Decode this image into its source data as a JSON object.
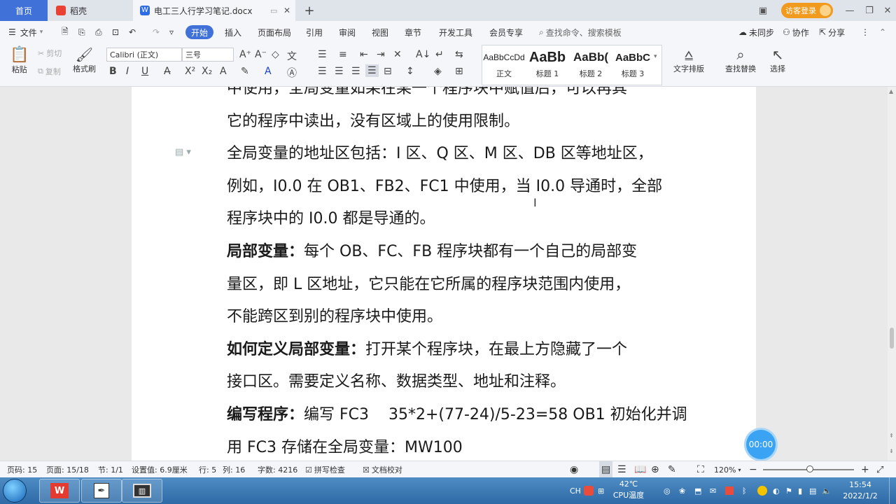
{
  "tabs": {
    "home": "首页",
    "daoke": "稻壳",
    "doc": "电工三人行学习笔记.docx",
    "add": "+"
  },
  "login": "访客登录",
  "menu": {
    "file": "文件",
    "start": "开始",
    "insert": "插入",
    "layout": "页面布局",
    "reference": "引用",
    "review": "审阅",
    "view": "视图",
    "chapter": "章节",
    "devtools": "开发工具",
    "member": "会员专享",
    "search": "查找命令、搜索模板",
    "sync": "未同步",
    "collab": "协作",
    "share": "分享"
  },
  "ribbon": {
    "paste": "粘贴",
    "cut": "剪切",
    "copy": "复制",
    "format_painter": "格式刷",
    "font": "Calibri (正文)",
    "size": "三号",
    "text_layout": "文字排版",
    "find_replace": "查找替换",
    "select": "选择",
    "styles": [
      {
        "sample": "AaBbCcDd",
        "name": "正文"
      },
      {
        "sample": "AaBb",
        "name": "标题 1"
      },
      {
        "sample": "AaBb(",
        "name": "标题 2"
      },
      {
        "sample": "AaBbC",
        "name": "标题 3"
      }
    ]
  },
  "document": {
    "lines": [
      {
        "bold": "",
        "text": "中使用，全局变量如果在某一个程序块中赋值后，可以再其"
      },
      {
        "bold": "",
        "text": "它的程序中读出，没有区域上的使用限制。"
      },
      {
        "bold": "",
        "text": "全局变量的地址区包括：I 区、Q 区、M 区、DB 区等地址区，"
      },
      {
        "bold": "",
        "text": "例如，I0.0 在 OB1、FB2、FC1 中使用，当 I0.0 导通时，全部"
      },
      {
        "bold": "",
        "text": "程序块中的 I0.0 都是导通的。"
      },
      {
        "bold": "局部变量：",
        "text": "每个 OB、FC、FB 程序块都有一个自己的局部变"
      },
      {
        "bold": "",
        "text": "量区，即 L 区地址，它只能在它所属的程序块范围内使用，"
      },
      {
        "bold": "",
        "text": "不能跨区到别的程序块中使用。"
      },
      {
        "bold": "如何定义局部变量：",
        "text": "打开某个程序块，在最上方隐藏了一个"
      },
      {
        "bold": "",
        "text": "接口区。需要定义名称、数据类型、地址和注释。"
      },
      {
        "bold": "编写程序：",
        "text": "编写 FC3    35*2+(77-24)/5-23=58 OB1 初始化并调"
      },
      {
        "bold": "",
        "text": "用 FC3 存储在全局变量：MW100"
      }
    ]
  },
  "timer": "00:00",
  "status": {
    "page": "页码: 15",
    "pages": "页面: 15/18",
    "section": "节: 1/1",
    "setting": "设置值: 6.9厘米",
    "row": "行: 5",
    "col": "列: 16",
    "words": "字数: 4216",
    "spell": "拼写检查",
    "proof": "文档校对",
    "zoom": "120%"
  },
  "taskbar": {
    "temp": "42℃",
    "cpu": "CPU温度",
    "lang": "CH",
    "time": "15:54",
    "date": "2022/1/2"
  }
}
